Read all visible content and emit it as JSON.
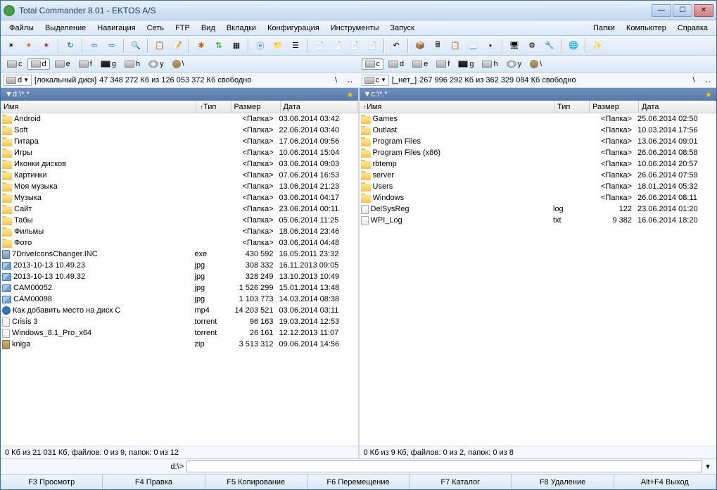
{
  "window": {
    "title": "Total Commander 8.01 - EKTOS A/S"
  },
  "menu": {
    "left": [
      "Файлы",
      "Выделение",
      "Навигация",
      "Сеть",
      "FTP",
      "Вид",
      "Вкладки",
      "Конфигурация",
      "Инструменты",
      "Запуск"
    ],
    "right": [
      "Папки",
      "Компьютер",
      "Справка"
    ]
  },
  "drives": [
    {
      "label": "c",
      "type": "hdd"
    },
    {
      "label": "d",
      "type": "hdd"
    },
    {
      "label": "e",
      "type": "hdd"
    },
    {
      "label": "f",
      "type": "hdd"
    },
    {
      "label": "g",
      "type": "usb"
    },
    {
      "label": "h",
      "type": "hdd"
    },
    {
      "label": "y",
      "type": "cd"
    },
    {
      "label": "\\",
      "type": "net"
    }
  ],
  "left": {
    "activeDrive": "d",
    "driveLetter": "d",
    "volLabel": "[локальный диск]",
    "free": "47 348 272 Кб из 126 053 372 Кб свободно",
    "tab": "d:\\*.*",
    "headers": {
      "name": "Имя",
      "ext": "Тип",
      "size": "Размер",
      "date": "Дата"
    },
    "files": [
      {
        "icon": "folder",
        "name": "Android",
        "ext": "",
        "size": "<Папка>",
        "date": "03.06.2014 03:42"
      },
      {
        "icon": "folder",
        "name": "Soft",
        "ext": "",
        "size": "<Папка>",
        "date": "22.06.2014 03:40"
      },
      {
        "icon": "folder",
        "name": "Гитара",
        "ext": "",
        "size": "<Папка>",
        "date": "17.06.2014 09:56"
      },
      {
        "icon": "folder",
        "name": "Игры",
        "ext": "",
        "size": "<Папка>",
        "date": "10.06.2014 15:04"
      },
      {
        "icon": "folder",
        "name": "Иконки дисков",
        "ext": "",
        "size": "<Папка>",
        "date": "03.06.2014 09:03"
      },
      {
        "icon": "folder",
        "name": "Картинки",
        "ext": "",
        "size": "<Папка>",
        "date": "07.06.2014 16:53"
      },
      {
        "icon": "folder",
        "name": "Моя музыка",
        "ext": "",
        "size": "<Папка>",
        "date": "13.06.2014 21:23"
      },
      {
        "icon": "folder",
        "name": "Музыка",
        "ext": "",
        "size": "<Папка>",
        "date": "03.06.2014 04:17"
      },
      {
        "icon": "folder",
        "name": "Сайт",
        "ext": "",
        "size": "<Папка>",
        "date": "23.06.2014 00:11"
      },
      {
        "icon": "folder",
        "name": "Табы",
        "ext": "",
        "size": "<Папка>",
        "date": "05.06.2014 11:25"
      },
      {
        "icon": "folder",
        "name": "Фильмы",
        "ext": "",
        "size": "<Папка>",
        "date": "18.06.2014 23:46"
      },
      {
        "icon": "folder",
        "name": "Фото",
        "ext": "",
        "size": "<Папка>",
        "date": "03.06.2014 04:48"
      },
      {
        "icon": "exe",
        "name": "7DriveIconsChanger.INC",
        "ext": "exe",
        "size": "430 592",
        "date": "16.05.2011 23:32"
      },
      {
        "icon": "img",
        "name": "2013-10-13 10.49.23",
        "ext": "jpg",
        "size": "308 332",
        "date": "16.11.2013 09:05"
      },
      {
        "icon": "img",
        "name": "2013-10-13 10.49.32",
        "ext": "jpg",
        "size": "328 249",
        "date": "13.10.2013 10:49"
      },
      {
        "icon": "img",
        "name": "CAM00052",
        "ext": "jpg",
        "size": "1 526 299",
        "date": "15.01.2014 13:48"
      },
      {
        "icon": "img",
        "name": "CAM00098",
        "ext": "jpg",
        "size": "1 103 773",
        "date": "14.03.2014 08:38"
      },
      {
        "icon": "vid",
        "name": "Как добавить место на диск С",
        "ext": "mp4",
        "size": "14 203 521",
        "date": "03.06.2014 03:11"
      },
      {
        "icon": "file",
        "name": "Crisis 3",
        "ext": "torrent",
        "size": "96 163",
        "date": "19.03.2014 12:53"
      },
      {
        "icon": "file",
        "name": "Windows_8.1_Pro_x64",
        "ext": "torrent",
        "size": "26 161",
        "date": "12.12.2013 11:07"
      },
      {
        "icon": "zip",
        "name": "kniga",
        "ext": "zip",
        "size": "3 513 312",
        "date": "09.06.2014 14:56"
      }
    ],
    "status": "0 Кб из 21 031 Кб, файлов: 0 из 9, папок: 0 из 12"
  },
  "right": {
    "activeDrive": "c",
    "driveLetter": "c",
    "volLabel": "[_нет_]",
    "free": "267 996 292 Кб из 362 329 084 Кб свободно",
    "tab": "c:\\*.*",
    "headers": {
      "name": "Имя",
      "ext": "Тип",
      "size": "Размер",
      "date": "Дата"
    },
    "files": [
      {
        "icon": "folder",
        "name": "Games",
        "ext": "",
        "size": "<Папка>",
        "date": "25.06.2014 02:50"
      },
      {
        "icon": "folder",
        "name": "Outlast",
        "ext": "",
        "size": "<Папка>",
        "date": "10.03.2014 17:56"
      },
      {
        "icon": "folder",
        "name": "Program Files",
        "ext": "",
        "size": "<Папка>",
        "date": "13.06.2014 09:01"
      },
      {
        "icon": "folder",
        "name": "Program Files (x86)",
        "ext": "",
        "size": "<Папка>",
        "date": "26.06.2014 08:58"
      },
      {
        "icon": "folder",
        "name": "rbtemp",
        "ext": "",
        "size": "<Папка>",
        "date": "10.06.2014 20:57"
      },
      {
        "icon": "folder",
        "name": "server",
        "ext": "",
        "size": "<Папка>",
        "date": "26.06.2014 07:59"
      },
      {
        "icon": "folder",
        "name": "Users",
        "ext": "",
        "size": "<Папка>",
        "date": "18.01.2014 05:32"
      },
      {
        "icon": "folder",
        "name": "Windows",
        "ext": "",
        "size": "<Папка>",
        "date": "26.06.2014 08:11"
      },
      {
        "icon": "file",
        "name": "DelSysReg",
        "ext": "log",
        "size": "122",
        "date": "23.06.2014 01:20"
      },
      {
        "icon": "file",
        "name": "WPI_Log",
        "ext": "txt",
        "size": "9 382",
        "date": "16.06.2014 18:20"
      }
    ],
    "status": "0 Кб из 9 Кб, файлов: 0 из 2, папок: 0 из 8"
  },
  "cmd": {
    "prompt": "d:\\>",
    "value": ""
  },
  "fnkeys": [
    "F3 Просмотр",
    "F4 Правка",
    "F5 Копирование",
    "F6 Перемещение",
    "F7 Каталог",
    "F8 Удаление",
    "Alt+F4 Выход"
  ]
}
